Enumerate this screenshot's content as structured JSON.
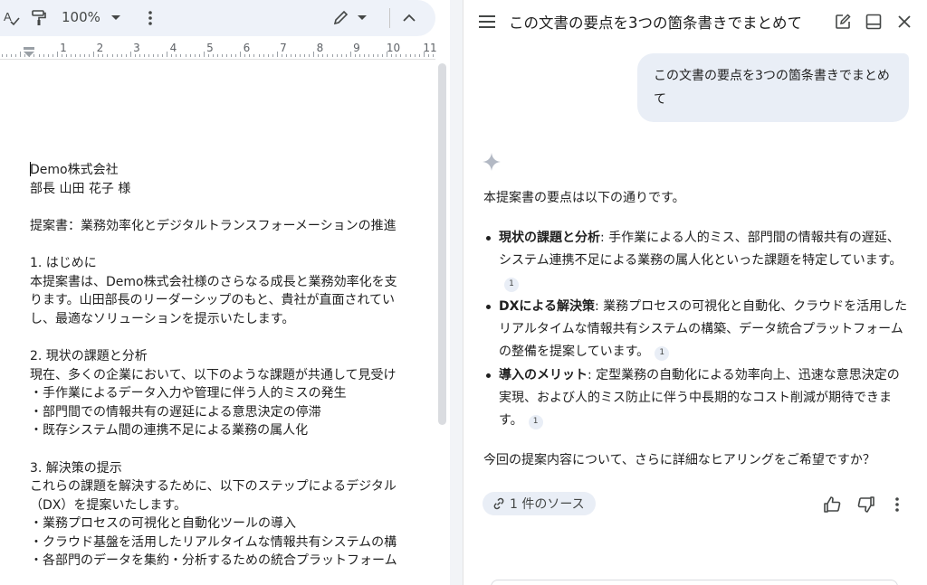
{
  "toolbar": {
    "zoom_label": "100%",
    "icons": [
      "spellcheck-icon",
      "paint-format-icon",
      "chevron-down-icon",
      "more-vert-icon",
      "pen-edit-icon",
      "chevron-down-icon",
      "chevron-up-icon"
    ]
  },
  "ruler": {
    "numbers": [
      "1",
      "2",
      "3",
      "4",
      "5",
      "6",
      "7",
      "8",
      "9",
      "10",
      "11"
    ]
  },
  "document": {
    "lines": [
      "Demo株式会社",
      "部長 山田 花子 様",
      "",
      "提案書：業務効率化とデジタルトランスフォーメーションの推進",
      "",
      "1. はじめに",
      "本提案書は、Demo株式会社様のさらなる成長と業務効率化を支",
      "ります。山田部長のリーダーシップのもと、貴社が直面されてい",
      "し、最適なソリューションを提示いたします。",
      "",
      "2. 現状の課題と分析",
      "現在、多くの企業において、以下のような課題が共通して見受け",
      "・手作業によるデータ入力や管理に伴う人的ミスの発生",
      "・部門間での情報共有の遅延による意思決定の停滞",
      "・既存システム間の連携不足による業務の属人化",
      "",
      "3. 解決策の提示",
      "これらの課題を解決するために、以下のステップによるデジタル",
      "（DX）を提案いたします。",
      "・業務プロセスの可視化と自動化ツールの導入",
      "・クラウド基盤を活用したリアルタイムな情報共有システムの構",
      "・各部門のデータを集約・分析するための統合プラットフォーム"
    ]
  },
  "panel": {
    "title": "この文書の要点を3つの箇条書きでまとめて",
    "user_prompt": "この文書の要点を3つの箇条書きでまとめて",
    "answer_intro": "本提案書の要点は以下の通りです。",
    "bullets": [
      {
        "heading": "現状の課題と分析",
        "text": ": 手作業による人的ミス、部門間の情報共有の遅延、システム連携不足による業務の属人化といった課題を特定しています。",
        "citation": "1"
      },
      {
        "heading": "DXによる解決策",
        "text": ": 業務プロセスの可視化と自動化、クラウドを活用したリアルタイムな情報共有システムの構築、データ統合プラットフォームの整備を提案しています。",
        "citation": "1"
      },
      {
        "heading": "導入のメリット",
        "text": ": 定型業務の自動化による効率向上、迅速な意思決定の実現、および人的ミス防止に伴う中長期的なコスト削減が期待できます。",
        "citation": "1"
      }
    ],
    "answer_outro": "今回の提案内容について、さらに詳細なヒアリングをご希望ですか？",
    "source_chip": "1 件のソース",
    "icons": [
      "menu-icon",
      "edit-icon",
      "dock-icon",
      "close-icon",
      "sparkle-icon",
      "link-icon",
      "thumb-up-icon",
      "thumb-down-icon",
      "more-vert-icon"
    ]
  }
}
